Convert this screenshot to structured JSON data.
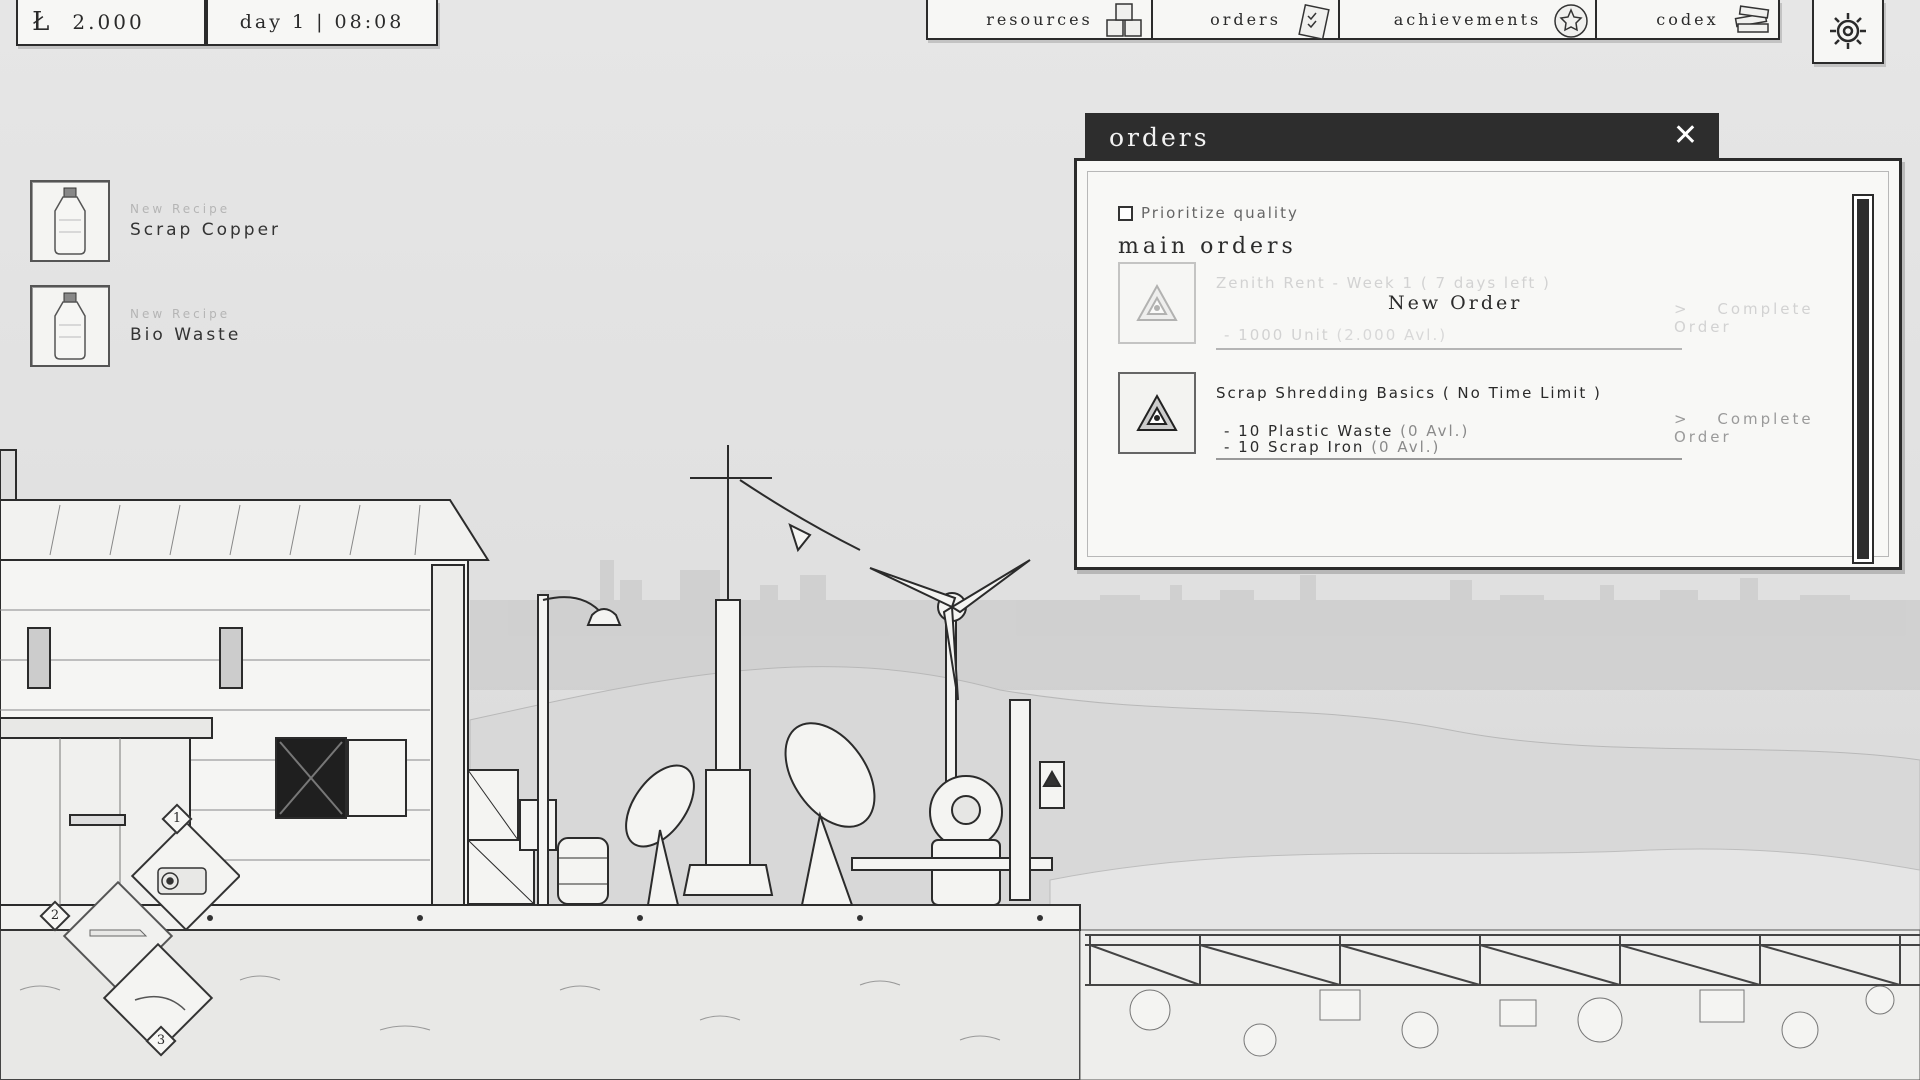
{
  "hud": {
    "money_icon": "currency-icon",
    "money": "2.000",
    "clock": "day 1 | 08:08"
  },
  "nav": {
    "tabs": [
      {
        "label": "resources",
        "icon": "crates-icon"
      },
      {
        "label": "orders",
        "icon": "clipboard-icon"
      },
      {
        "label": "achievements",
        "icon": "star-badge-icon"
      },
      {
        "label": "codex",
        "icon": "books-icon"
      }
    ],
    "settings_icon": "gear-icon"
  },
  "recipes": [
    {
      "caption": "New Recipe",
      "name": "Scrap Copper",
      "icon": "bottle-icon"
    },
    {
      "caption": "New Recipe",
      "name": "Bio Waste",
      "icon": "bottle-icon"
    }
  ],
  "orders_panel": {
    "title": "orders",
    "close_icon": "close-icon",
    "prioritize_label": "Prioritize quality",
    "prioritize_checked": false,
    "section_title": "main orders",
    "orders": [
      {
        "title": "Zenith Rent - Week 1 ( 7 days left )",
        "overlay": "New Order",
        "requirements": [
          {
            "text": "- 1000 Unit",
            "available": "(2.000 Avl.)"
          }
        ],
        "action": "Complete Order",
        "arrow": ">",
        "faded": true
      },
      {
        "title": "Scrap Shredding Basics ( No Time Limit )",
        "requirements": [
          {
            "text": "- 10 Plastic Waste",
            "available": "(0 Avl.)"
          },
          {
            "text": "- 10 Scrap Iron",
            "available": "(0 Avl.)"
          }
        ],
        "action": "Complete Order",
        "arrow": ">",
        "faded": false
      }
    ]
  },
  "hotbar": {
    "slots": [
      "1",
      "2",
      "3"
    ]
  },
  "colors": {
    "ink": "#2b2b2b",
    "paper": "#f7f7f5",
    "sky": "#e4e4e4",
    "panel_header": "#2d2d2d"
  }
}
